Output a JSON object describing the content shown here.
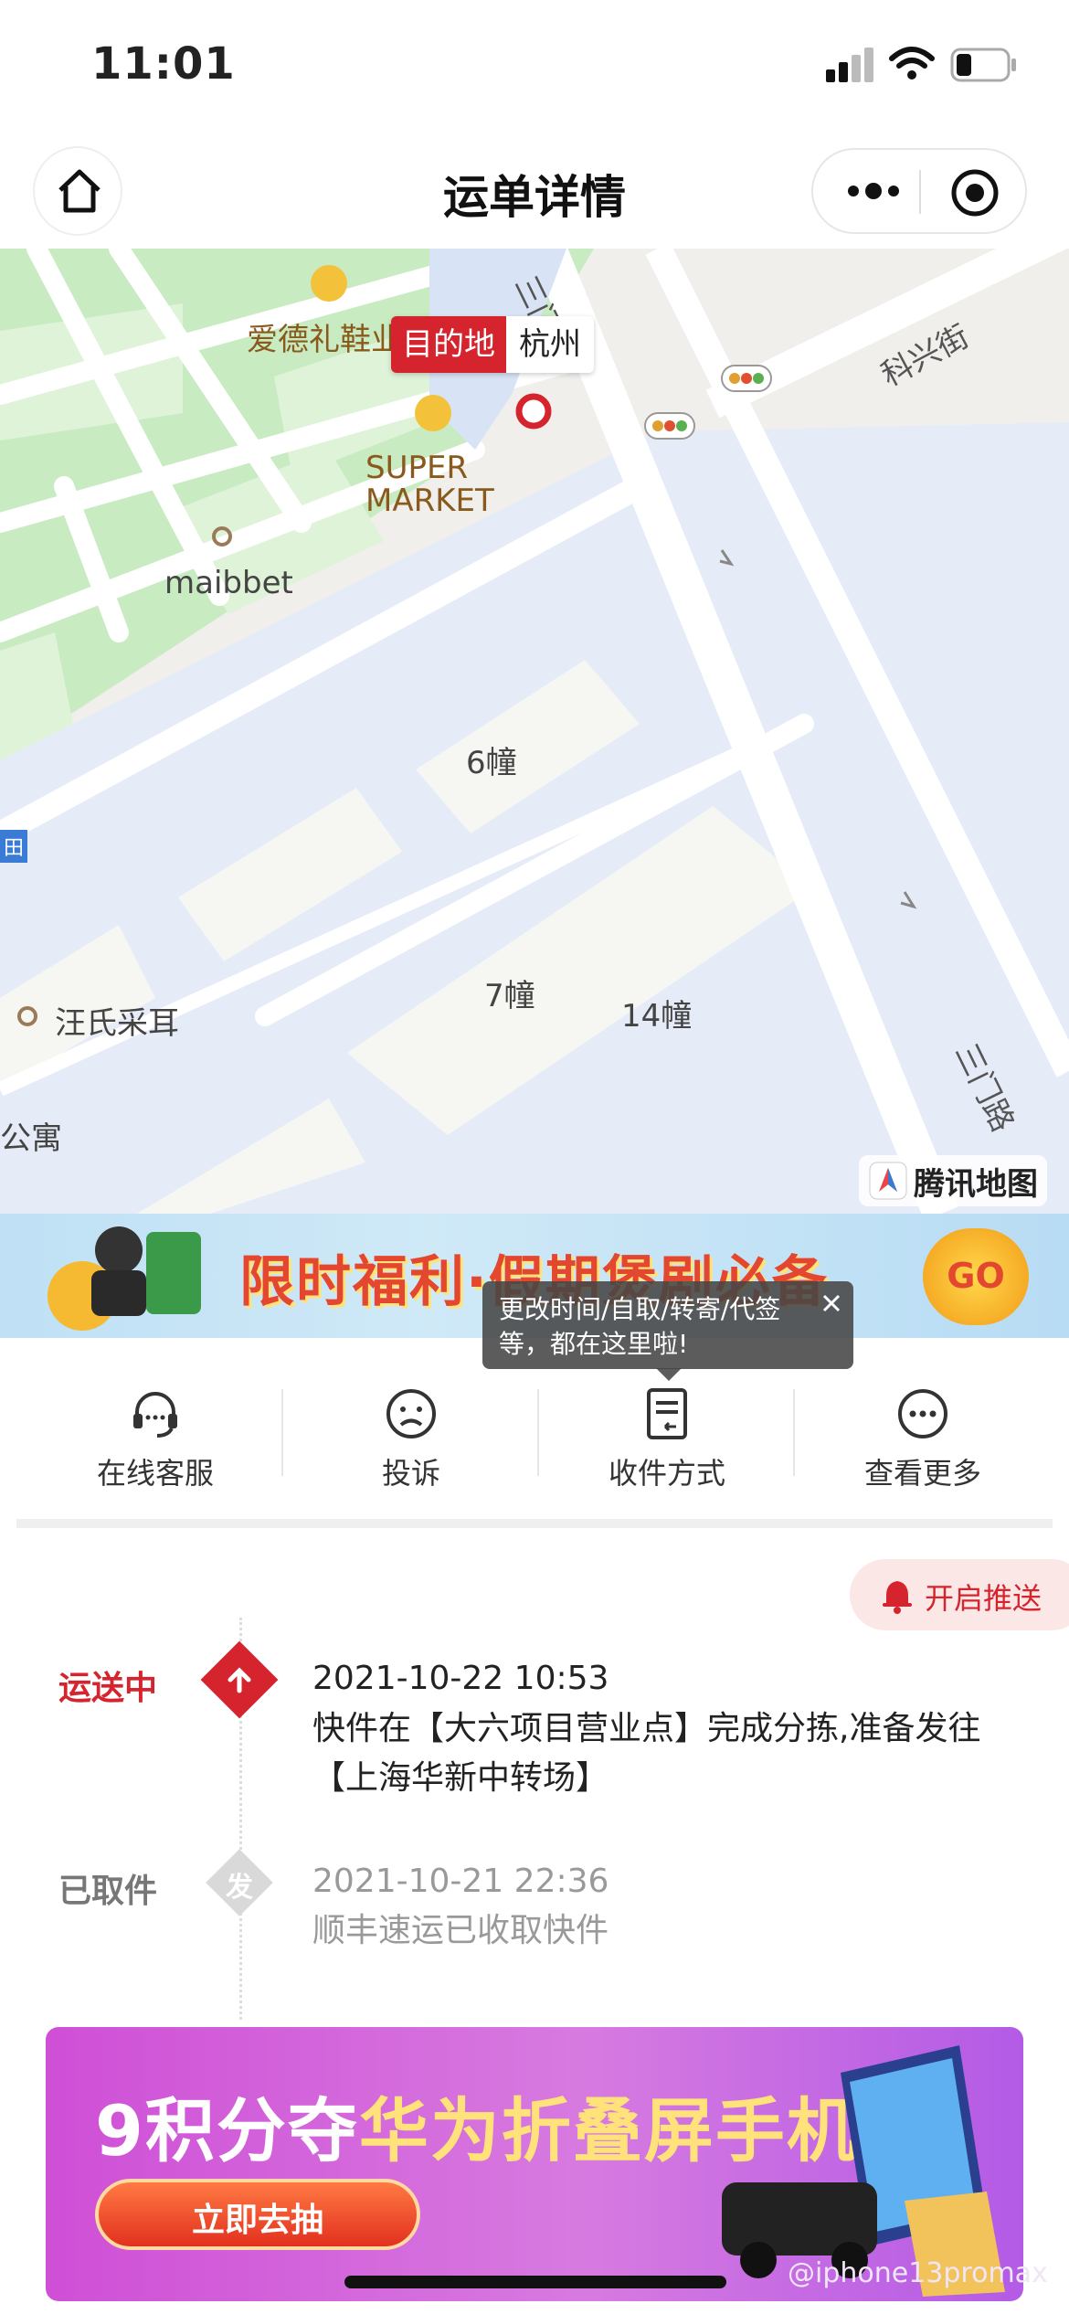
{
  "status_bar": {
    "time": "11:01"
  },
  "nav": {
    "title": "运单详情"
  },
  "map": {
    "destination_tag": "目的地",
    "destination_city": "杭州",
    "roads": [
      "三门路",
      "科兴街",
      "三门路"
    ],
    "places": [
      "爱德礼鞋业",
      "SUPER",
      "MARKET",
      "maibbet",
      "6幢",
      "7幢",
      "14幢",
      "汪氏采耳",
      "公寓",
      "田"
    ],
    "attribution": "腾讯地图"
  },
  "promo_banner": {
    "text": "限时福利·假期煲剧必备",
    "go": "GO"
  },
  "tooltip": {
    "text": "更改时间/自取/转寄/代签等，都在这里啦!"
  },
  "actions": [
    {
      "label": "在线客服",
      "icon": "headset-icon"
    },
    {
      "label": "投诉",
      "icon": "sad-face-icon"
    },
    {
      "label": "收件方式",
      "icon": "document-return-icon"
    },
    {
      "label": "查看更多",
      "icon": "more-dots-icon"
    }
  ],
  "push_button": {
    "label": "开启推送",
    "icon": "bell-icon"
  },
  "timeline": [
    {
      "status": "运送中",
      "time": "2021-10-22 10:53",
      "desc": "快件在【大六项目营业点】完成分拣,准备发往【上海华新中转场】",
      "badge": "arrow-up-icon"
    },
    {
      "status": "已取件",
      "time": "2021-10-21 22:36",
      "desc": "顺丰速运已收取快件",
      "badge_text": "发"
    }
  ],
  "bottom_banner": {
    "title_num": "9",
    "title_mid": "积分夺",
    "title_hl": "华为折叠屏手机",
    "button": "立即去抽",
    "watermark": "@iphone13promax"
  },
  "colors": {
    "accent": "#d6242e",
    "muted": "#999999",
    "map_water": "#e6ecf7",
    "map_green": "#c8ebc2"
  }
}
